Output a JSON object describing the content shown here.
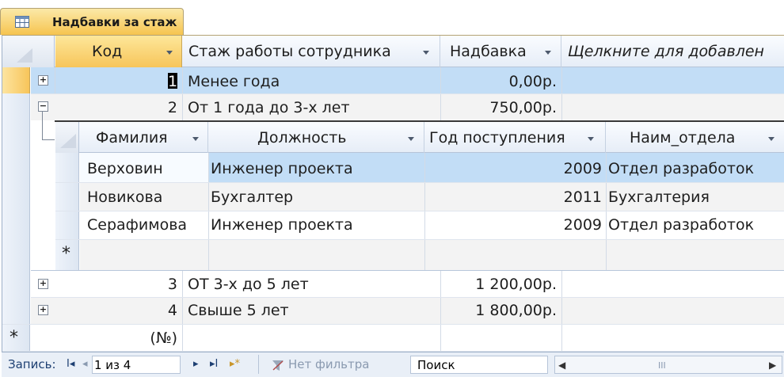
{
  "tab": {
    "title": "Надбавки за стаж",
    "icon": "table-icon"
  },
  "columns": {
    "kod": "Код",
    "stazh": "Стаж работы сотрудника",
    "nadbavka": "Надбавка",
    "add": "Щелкните для добавлен"
  },
  "rows": [
    {
      "kod": "1",
      "stazh": "Менее года",
      "nadbavka": "0,00р."
    },
    {
      "kod": "2",
      "stazh": "От 1 года до 3-х лет",
      "nadbavka": "750,00р."
    },
    {
      "kod": "3",
      "stazh": "ОТ 3-х до 5 лет",
      "nadbavka": "1 200,00р."
    },
    {
      "kod": "4",
      "stazh": "Свыше 5 лет",
      "nadbavka": "1 800,00р."
    }
  ],
  "new_row": {
    "marker": "*",
    "kod_placeholder": "(№)"
  },
  "subtable": {
    "columns": {
      "familia": "Фамилия",
      "dolzhnost": "Должность",
      "god": "Год поступления",
      "otdel": "Наим_отдела"
    },
    "rows": [
      {
        "familia": "Верховин",
        "dolzhnost": "Инженер проекта",
        "god": "2009",
        "otdel": "Отдел разработок"
      },
      {
        "familia": "Новикова",
        "dolzhnost": "Бухгалтер",
        "god": "2011",
        "otdel": "Бухгалтерия"
      },
      {
        "familia": "Серафимова",
        "dolzhnost": "Инженер проекта",
        "god": "2009",
        "otdel": "Отдел разработок"
      }
    ],
    "new_marker": "*"
  },
  "expanders": {
    "collapsed": "+",
    "expanded": "−"
  },
  "nav": {
    "label": "Запись:",
    "first": "I◂",
    "prev": "◂",
    "record": "1 из 4",
    "next": "▸",
    "last": "▸I",
    "new": "▸*",
    "filter": "Нет фильтра",
    "search": "Поиск",
    "scroll_left": "◀",
    "scroll_right": "▶",
    "scroll_thumb": "III"
  },
  "colors": {
    "selected_row": "#c2ddf6",
    "header_selected": "#f9d36e",
    "grid_line": "#d3dbe6",
    "nav_text": "#1d3f72"
  }
}
